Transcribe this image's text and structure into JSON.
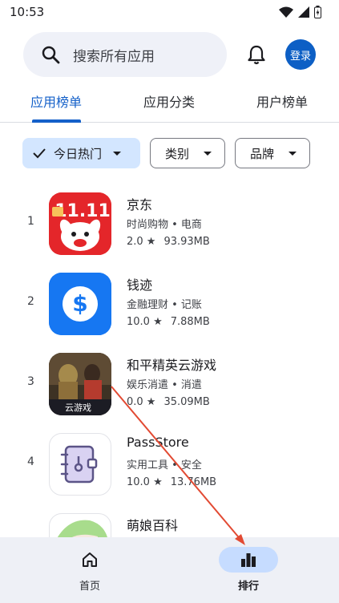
{
  "status_bar": {
    "time": "10:53"
  },
  "search": {
    "placeholder": "搜索所有应用"
  },
  "header": {
    "login_label": "登录"
  },
  "tabs": [
    {
      "label": "应用榜单",
      "active": true
    },
    {
      "label": "应用分类",
      "active": false
    },
    {
      "label": "用户榜单",
      "active": false
    }
  ],
  "filters": [
    {
      "label": "今日热门",
      "selected": true
    },
    {
      "label": "类别",
      "selected": false
    },
    {
      "label": "品牌",
      "selected": false
    }
  ],
  "apps": [
    {
      "rank": "1",
      "name": "京东",
      "category": "时尚购物 • 电商",
      "rating": "2.0 ★",
      "size": "93.93MB",
      "icon": "jd-icon"
    },
    {
      "rank": "2",
      "name": "钱迹",
      "category": "金融理财 • 记账",
      "rating": "10.0 ★",
      "size": "7.88MB",
      "icon": "dollar-icon"
    },
    {
      "rank": "3",
      "name": "和平精英云游戏",
      "category": "娱乐消遣 • 消遣",
      "rating": "0.0 ★",
      "size": "35.09MB",
      "icon": "game-icon",
      "icon_text": "云游戏"
    },
    {
      "rank": "4",
      "name": "PassStore",
      "category": "实用工具 • 安全",
      "rating": "10.0 ★",
      "size": "13.76MB",
      "icon": "notebook-lock-icon"
    },
    {
      "rank": "",
      "name": "萌娘百科",
      "category": "",
      "rating": "",
      "size": "",
      "icon": "moegirl-icon"
    }
  ],
  "bottom_nav": [
    {
      "label": "首页",
      "active": false,
      "icon": "home-icon"
    },
    {
      "label": "排行",
      "active": true,
      "icon": "bar-chart-icon"
    }
  ],
  "colors": {
    "accent": "#1460c9",
    "annotation_arrow": "#e24a33"
  }
}
